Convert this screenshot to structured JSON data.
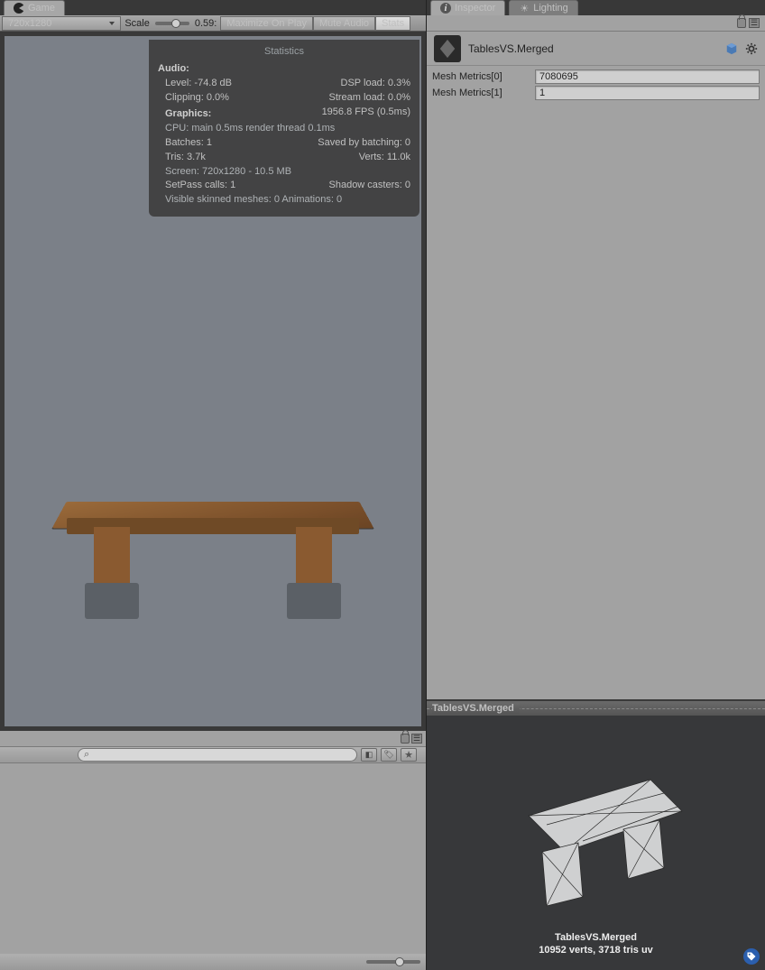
{
  "game": {
    "tab_label": "Game",
    "resolution": "720x1280",
    "scale_label": "Scale",
    "scale_value": "0.59:",
    "btn_max": "Maximize On Play",
    "btn_mute": "Mute Audio",
    "btn_stats": "Stats"
  },
  "stats": {
    "title": "Statistics",
    "audio_h": "Audio:",
    "level": "Level: -74.8 dB",
    "dsp": "DSP load: 0.3%",
    "clipping": "Clipping: 0.0%",
    "stream": "Stream load: 0.0%",
    "gfx_h": "Graphics:",
    "fps": "1956.8 FPS (0.5ms)",
    "cpu": "CPU: main 0.5ms   render thread 0.1ms",
    "batches_l": "Batches: 1",
    "batches_r": "Saved by batching: 0",
    "tris_l": "Tris: 3.7k",
    "tris_r": "Verts: 11.0k",
    "screen": "Screen: 720x1280 - 10.5 MB",
    "setpass_l": "SetPass calls: 1",
    "setpass_r": "Shadow casters: 0",
    "skinned": "Visible skinned meshes: 0   Animations: 0"
  },
  "inspector": {
    "tab_inspector": "Inspector",
    "tab_lighting": "Lighting",
    "asset_name": "TablesVS.Merged",
    "metrics": [
      {
        "label": "Mesh Metrics[0]",
        "value": "7080695"
      },
      {
        "label": "Mesh Metrics[1]",
        "value": "1"
      }
    ]
  },
  "preview": {
    "title": "TablesVS.Merged",
    "name": "TablesVS.Merged",
    "info": "10952 verts, 3718 tris    uv"
  },
  "search": {
    "placeholder": ""
  }
}
